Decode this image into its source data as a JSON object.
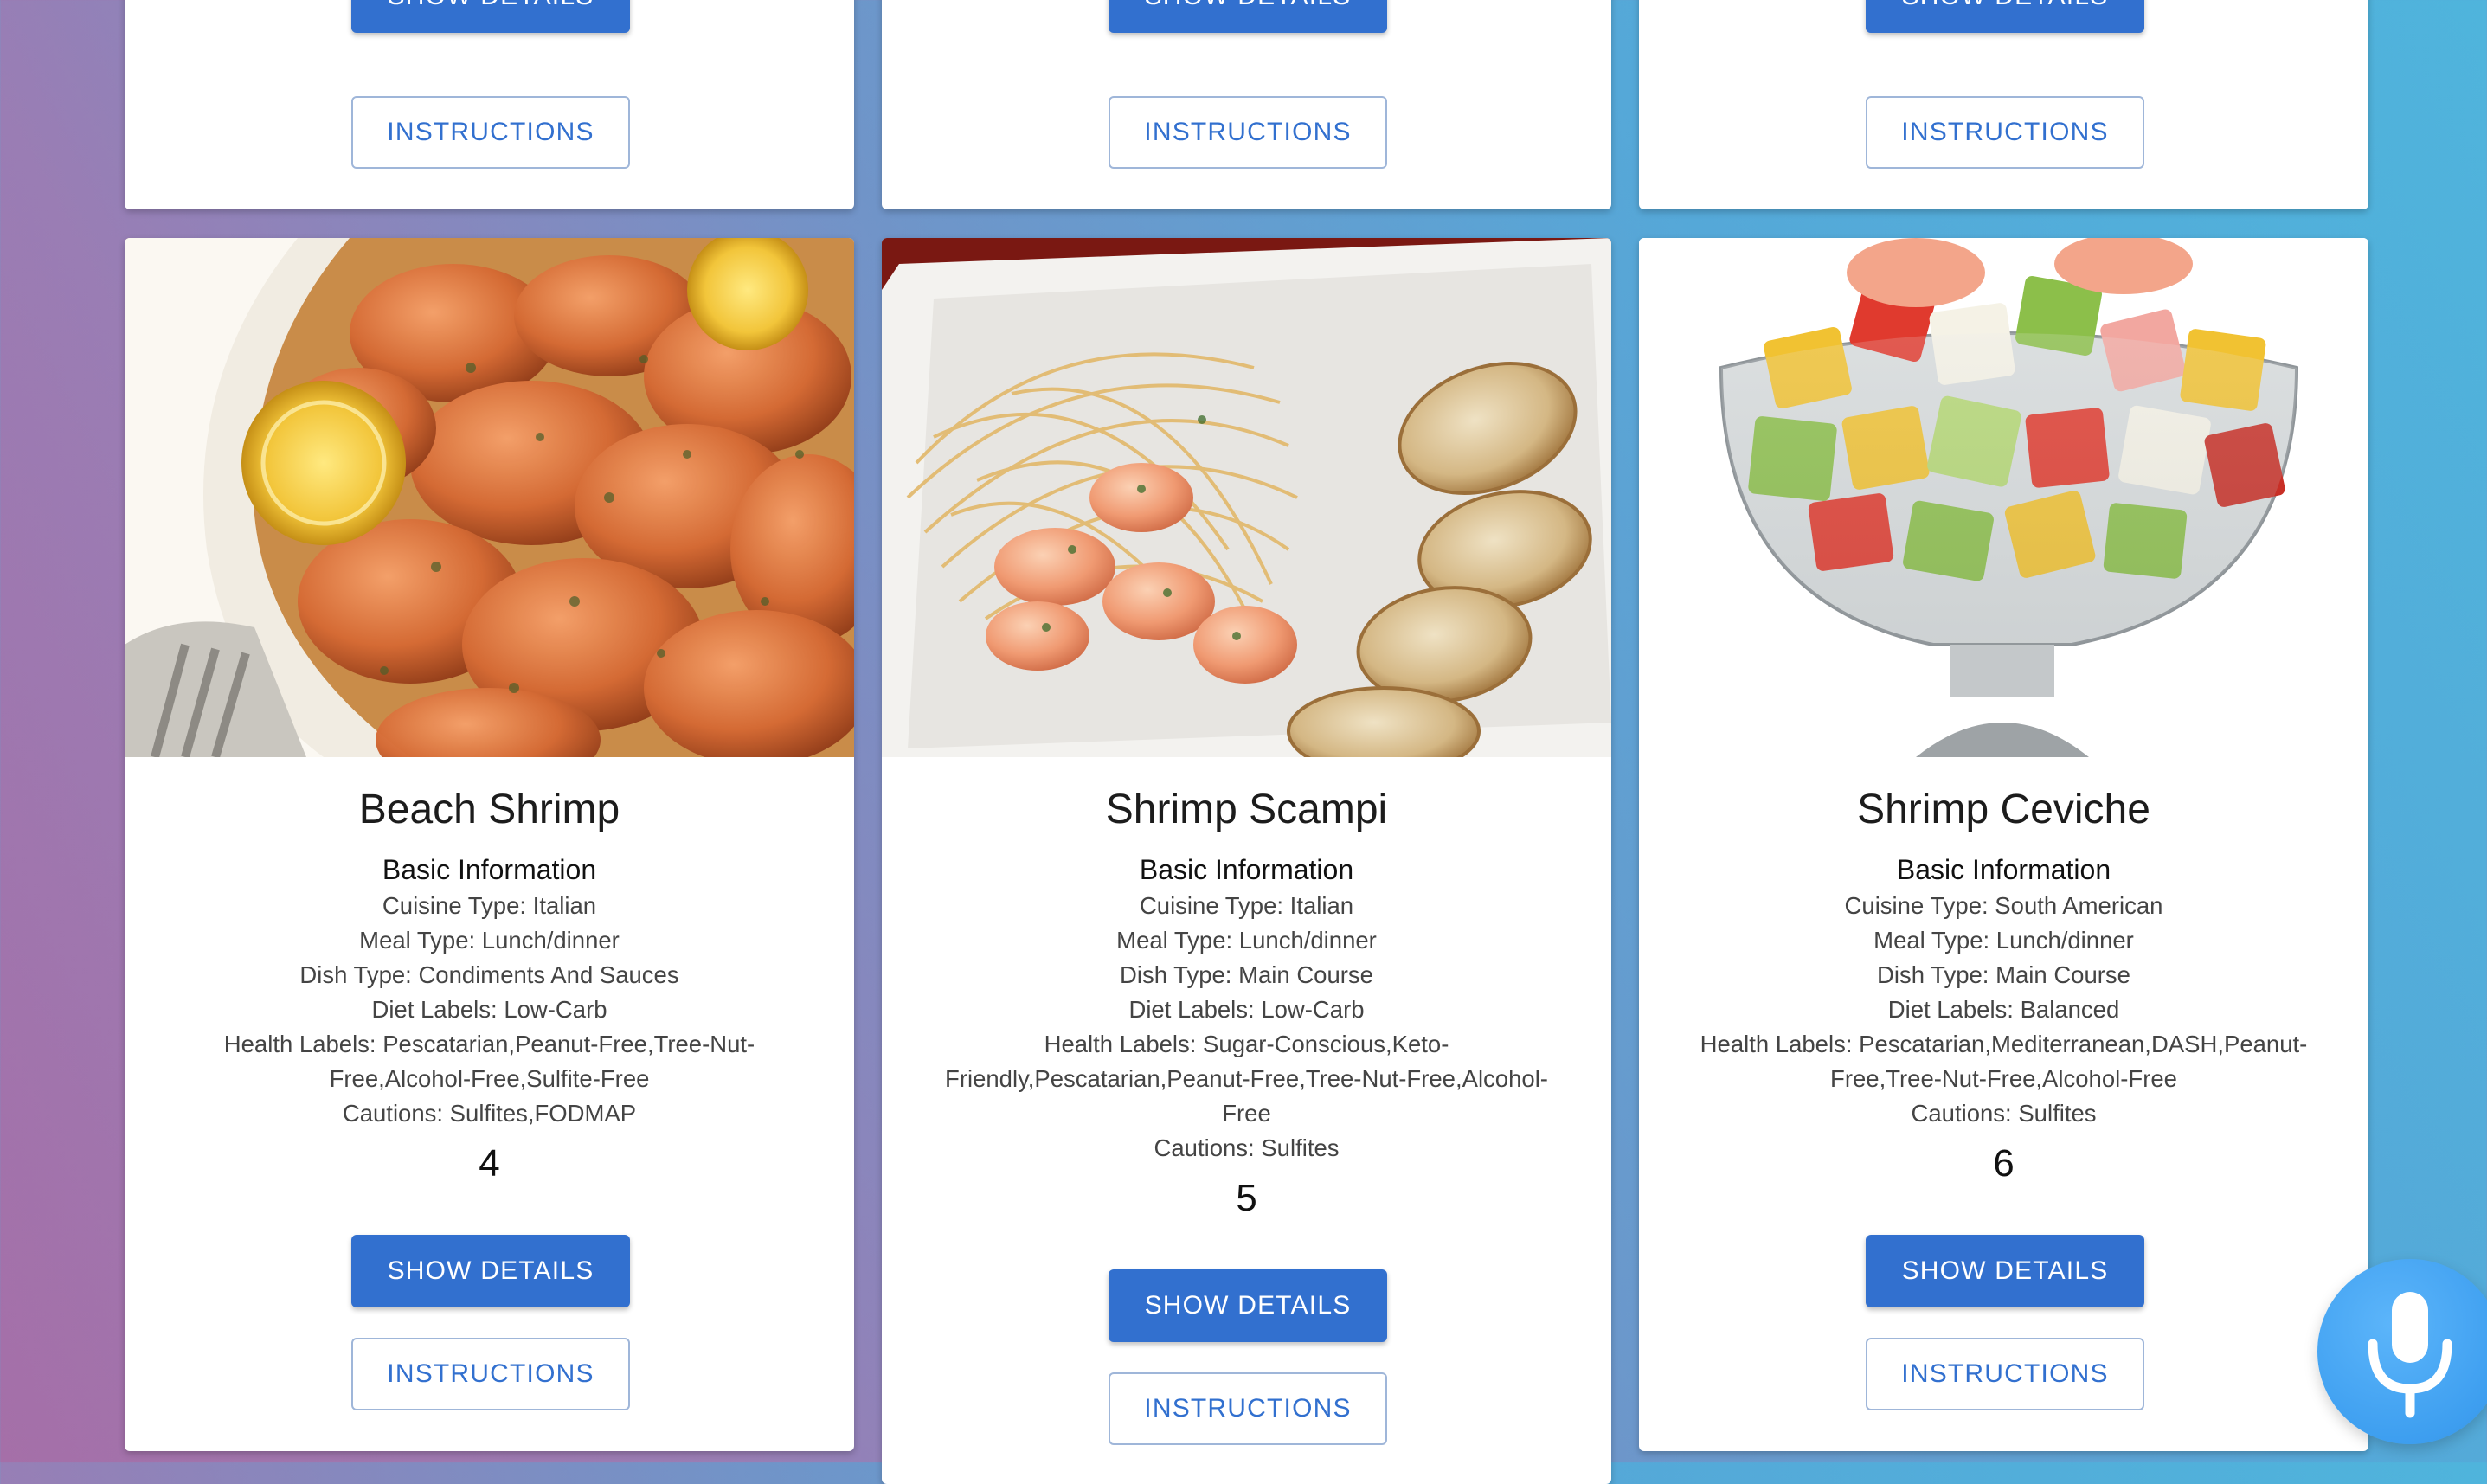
{
  "top_row": [
    {
      "show_details_label": "SHOW DETAILS",
      "instructions_label": "INSTRUCTIONS"
    },
    {
      "show_details_label": "SHOW DETAILS",
      "instructions_label": "INSTRUCTIONS"
    },
    {
      "show_details_label": "SHOW DETAILS",
      "instructions_label": "INSTRUCTIONS"
    }
  ],
  "recipes": [
    {
      "title": "Beach Shrimp",
      "section_label": "Basic Information",
      "details": [
        "Cuisine Type: Italian",
        "Meal Type: Lunch/dinner",
        "Dish Type: Condiments And Sauces",
        "Diet Labels: Low-Carb",
        "Health Labels: Pescatarian,Peanut-Free,Tree-Nut-",
        "Free,Alcohol-Free,Sulfite-Free",
        "Cautions: Sulfites,FODMAP"
      ],
      "number": "4",
      "show_details_label": "SHOW DETAILS",
      "instructions_label": "INSTRUCTIONS"
    },
    {
      "title": "Shrimp Scampi",
      "section_label": "Basic Information",
      "details": [
        "Cuisine Type: Italian",
        "Meal Type: Lunch/dinner",
        "Dish Type: Main Course",
        "Diet Labels: Low-Carb",
        "Health Labels: Sugar-Conscious,Keto-",
        "Friendly,Pescatarian,Peanut-Free,Tree-Nut-Free,Alcohol-",
        "Free",
        "Cautions: Sulfites"
      ],
      "number": "5",
      "show_details_label": "SHOW DETAILS",
      "instructions_label": "INSTRUCTIONS"
    },
    {
      "title": "Shrimp Ceviche",
      "section_label": "Basic Information",
      "details": [
        "Cuisine Type: South American",
        "Meal Type: Lunch/dinner",
        "Dish Type: Main Course",
        "Diet Labels: Balanced",
        "Health Labels: Pescatarian,Mediterranean,DASH,Peanut-",
        "Free,Tree-Nut-Free,Alcohol-Free",
        "Cautions: Sulfites"
      ],
      "number": "6",
      "show_details_label": "SHOW DETAILS",
      "instructions_label": "INSTRUCTIONS"
    }
  ],
  "icons": {
    "mic": "microphone-icon"
  },
  "colors": {
    "primary": "#3270cf",
    "mic_button": "#3e9ff0",
    "card": "#ffffff"
  }
}
